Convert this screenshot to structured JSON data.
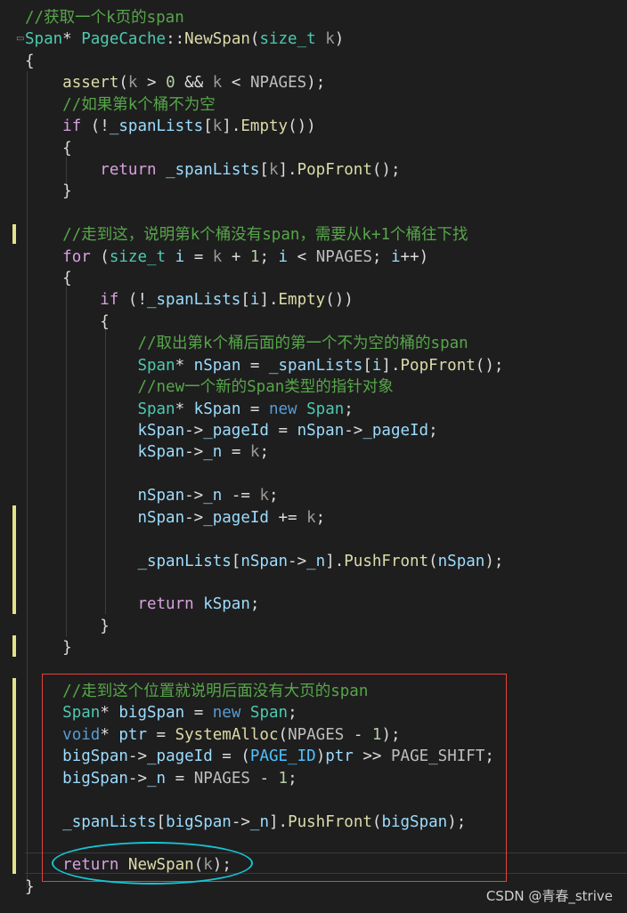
{
  "editor": {
    "lines": [
      [
        {
          "c": "comment",
          "t": "//获取一个k页的span"
        }
      ],
      [
        {
          "c": "type",
          "t": "Span"
        },
        {
          "c": "plain",
          "t": "* "
        },
        {
          "c": "type",
          "t": "PageCache"
        },
        {
          "c": "plain",
          "t": "::"
        },
        {
          "c": "func",
          "t": "NewSpan"
        },
        {
          "c": "plain",
          "t": "("
        },
        {
          "c": "type",
          "t": "size_t"
        },
        {
          "c": "plain",
          "t": " "
        },
        {
          "c": "param",
          "t": "k"
        },
        {
          "c": "plain",
          "t": ")"
        }
      ],
      [
        {
          "c": "plain",
          "t": "{"
        }
      ],
      [
        {
          "c": "plain",
          "t": "    "
        },
        {
          "c": "func",
          "t": "assert"
        },
        {
          "c": "plain",
          "t": "("
        },
        {
          "c": "param",
          "t": "k"
        },
        {
          "c": "plain",
          "t": " > "
        },
        {
          "c": "num",
          "t": "0"
        },
        {
          "c": "plain",
          "t": " && "
        },
        {
          "c": "param",
          "t": "k"
        },
        {
          "c": "plain",
          "t": " < "
        },
        {
          "c": "macro",
          "t": "NPAGES"
        },
        {
          "c": "plain",
          "t": ");"
        }
      ],
      [
        {
          "c": "plain",
          "t": "    "
        },
        {
          "c": "comment",
          "t": "//如果第k个桶不为空"
        }
      ],
      [
        {
          "c": "plain",
          "t": "    "
        },
        {
          "c": "ctrl",
          "t": "if"
        },
        {
          "c": "plain",
          "t": " (!"
        },
        {
          "c": "var",
          "t": "_spanLists"
        },
        {
          "c": "plain",
          "t": "["
        },
        {
          "c": "param",
          "t": "k"
        },
        {
          "c": "plain",
          "t": "]."
        },
        {
          "c": "func",
          "t": "Empty"
        },
        {
          "c": "plain",
          "t": "())"
        }
      ],
      [
        {
          "c": "plain",
          "t": "    {"
        }
      ],
      [
        {
          "c": "plain",
          "t": "        "
        },
        {
          "c": "ctrl",
          "t": "return"
        },
        {
          "c": "plain",
          "t": " "
        },
        {
          "c": "var",
          "t": "_spanLists"
        },
        {
          "c": "plain",
          "t": "["
        },
        {
          "c": "param",
          "t": "k"
        },
        {
          "c": "plain",
          "t": "]."
        },
        {
          "c": "func",
          "t": "PopFront"
        },
        {
          "c": "plain",
          "t": "();"
        }
      ],
      [
        {
          "c": "plain",
          "t": "    }"
        }
      ],
      [],
      [
        {
          "c": "plain",
          "t": "    "
        },
        {
          "c": "comment",
          "t": "//走到这，说明第k个桶没有span，需要从k+1个桶往下找"
        }
      ],
      [
        {
          "c": "plain",
          "t": "    "
        },
        {
          "c": "ctrl",
          "t": "for"
        },
        {
          "c": "plain",
          "t": " ("
        },
        {
          "c": "type",
          "t": "size_t"
        },
        {
          "c": "plain",
          "t": " "
        },
        {
          "c": "var",
          "t": "i"
        },
        {
          "c": "plain",
          "t": " = "
        },
        {
          "c": "param",
          "t": "k"
        },
        {
          "c": "plain",
          "t": " + "
        },
        {
          "c": "num",
          "t": "1"
        },
        {
          "c": "plain",
          "t": "; "
        },
        {
          "c": "var",
          "t": "i"
        },
        {
          "c": "plain",
          "t": " < "
        },
        {
          "c": "macro",
          "t": "NPAGES"
        },
        {
          "c": "plain",
          "t": "; "
        },
        {
          "c": "var",
          "t": "i"
        },
        {
          "c": "plain",
          "t": "++)"
        }
      ],
      [
        {
          "c": "plain",
          "t": "    {"
        }
      ],
      [
        {
          "c": "plain",
          "t": "        "
        },
        {
          "c": "ctrl",
          "t": "if"
        },
        {
          "c": "plain",
          "t": " (!"
        },
        {
          "c": "var",
          "t": "_spanLists"
        },
        {
          "c": "plain",
          "t": "["
        },
        {
          "c": "var",
          "t": "i"
        },
        {
          "c": "plain",
          "t": "]."
        },
        {
          "c": "func",
          "t": "Empty"
        },
        {
          "c": "plain",
          "t": "())"
        }
      ],
      [
        {
          "c": "plain",
          "t": "        {"
        }
      ],
      [
        {
          "c": "plain",
          "t": "            "
        },
        {
          "c": "comment",
          "t": "//取出第k个桶后面的第一个不为空的桶的span"
        }
      ],
      [
        {
          "c": "plain",
          "t": "            "
        },
        {
          "c": "type",
          "t": "Span"
        },
        {
          "c": "plain",
          "t": "* "
        },
        {
          "c": "var",
          "t": "nSpan"
        },
        {
          "c": "plain",
          "t": " = "
        },
        {
          "c": "var",
          "t": "_spanLists"
        },
        {
          "c": "plain",
          "t": "["
        },
        {
          "c": "var",
          "t": "i"
        },
        {
          "c": "plain",
          "t": "]."
        },
        {
          "c": "func",
          "t": "PopFront"
        },
        {
          "c": "plain",
          "t": "();"
        }
      ],
      [
        {
          "c": "plain",
          "t": "            "
        },
        {
          "c": "comment",
          "t": "//new一个新的Span类型的指针对象"
        }
      ],
      [
        {
          "c": "plain",
          "t": "            "
        },
        {
          "c": "type",
          "t": "Span"
        },
        {
          "c": "plain",
          "t": "* "
        },
        {
          "c": "var",
          "t": "kSpan"
        },
        {
          "c": "plain",
          "t": " = "
        },
        {
          "c": "kw",
          "t": "new"
        },
        {
          "c": "plain",
          "t": " "
        },
        {
          "c": "type",
          "t": "Span"
        },
        {
          "c": "plain",
          "t": ";"
        }
      ],
      [
        {
          "c": "plain",
          "t": "            "
        },
        {
          "c": "var",
          "t": "kSpan"
        },
        {
          "c": "plain",
          "t": "->"
        },
        {
          "c": "var",
          "t": "_pageId"
        },
        {
          "c": "plain",
          "t": " = "
        },
        {
          "c": "var",
          "t": "nSpan"
        },
        {
          "c": "plain",
          "t": "->"
        },
        {
          "c": "var",
          "t": "_pageId"
        },
        {
          "c": "plain",
          "t": ";"
        }
      ],
      [
        {
          "c": "plain",
          "t": "            "
        },
        {
          "c": "var",
          "t": "kSpan"
        },
        {
          "c": "plain",
          "t": "->"
        },
        {
          "c": "var",
          "t": "_n"
        },
        {
          "c": "plain",
          "t": " = "
        },
        {
          "c": "param",
          "t": "k"
        },
        {
          "c": "plain",
          "t": ";"
        }
      ],
      [],
      [
        {
          "c": "plain",
          "t": "            "
        },
        {
          "c": "var",
          "t": "nSpan"
        },
        {
          "c": "plain",
          "t": "->"
        },
        {
          "c": "var",
          "t": "_n"
        },
        {
          "c": "plain",
          "t": " -= "
        },
        {
          "c": "param",
          "t": "k"
        },
        {
          "c": "plain",
          "t": ";"
        }
      ],
      [
        {
          "c": "plain",
          "t": "            "
        },
        {
          "c": "var",
          "t": "nSpan"
        },
        {
          "c": "plain",
          "t": "->"
        },
        {
          "c": "var",
          "t": "_pageId"
        },
        {
          "c": "plain",
          "t": " += "
        },
        {
          "c": "param",
          "t": "k"
        },
        {
          "c": "plain",
          "t": ";"
        }
      ],
      [],
      [
        {
          "c": "plain",
          "t": "            "
        },
        {
          "c": "var",
          "t": "_spanLists"
        },
        {
          "c": "plain",
          "t": "["
        },
        {
          "c": "var",
          "t": "nSpan"
        },
        {
          "c": "plain",
          "t": "->"
        },
        {
          "c": "var",
          "t": "_n"
        },
        {
          "c": "plain",
          "t": "]."
        },
        {
          "c": "func",
          "t": "PushFront"
        },
        {
          "c": "plain",
          "t": "("
        },
        {
          "c": "var",
          "t": "nSpan"
        },
        {
          "c": "plain",
          "t": ");"
        }
      ],
      [],
      [
        {
          "c": "plain",
          "t": "            "
        },
        {
          "c": "ctrl",
          "t": "return"
        },
        {
          "c": "plain",
          "t": " "
        },
        {
          "c": "var",
          "t": "kSpan"
        },
        {
          "c": "plain",
          "t": ";"
        }
      ],
      [
        {
          "c": "plain",
          "t": "        }"
        }
      ],
      [
        {
          "c": "plain",
          "t": "    }"
        }
      ],
      [],
      [
        {
          "c": "plain",
          "t": "    "
        },
        {
          "c": "comment",
          "t": "//走到这个位置就说明后面没有大页的span"
        }
      ],
      [
        {
          "c": "plain",
          "t": "    "
        },
        {
          "c": "type",
          "t": "Span"
        },
        {
          "c": "plain",
          "t": "* "
        },
        {
          "c": "var",
          "t": "bigSpan"
        },
        {
          "c": "plain",
          "t": " = "
        },
        {
          "c": "kw",
          "t": "new"
        },
        {
          "c": "plain",
          "t": " "
        },
        {
          "c": "type",
          "t": "Span"
        },
        {
          "c": "plain",
          "t": ";"
        }
      ],
      [
        {
          "c": "plain",
          "t": "    "
        },
        {
          "c": "kw",
          "t": "void"
        },
        {
          "c": "plain",
          "t": "* "
        },
        {
          "c": "var",
          "t": "ptr"
        },
        {
          "c": "plain",
          "t": " = "
        },
        {
          "c": "func",
          "t": "SystemAlloc"
        },
        {
          "c": "plain",
          "t": "("
        },
        {
          "c": "macro",
          "t": "NPAGES"
        },
        {
          "c": "plain",
          "t": " - "
        },
        {
          "c": "num",
          "t": "1"
        },
        {
          "c": "plain",
          "t": ");"
        }
      ],
      [
        {
          "c": "plain",
          "t": "    "
        },
        {
          "c": "var",
          "t": "bigSpan"
        },
        {
          "c": "plain",
          "t": "->"
        },
        {
          "c": "var",
          "t": "_pageId"
        },
        {
          "c": "plain",
          "t": " = ("
        },
        {
          "c": "enum",
          "t": "PAGE_ID"
        },
        {
          "c": "plain",
          "t": ")"
        },
        {
          "c": "var",
          "t": "ptr"
        },
        {
          "c": "plain",
          "t": " >> "
        },
        {
          "c": "macro",
          "t": "PAGE_SHIFT"
        },
        {
          "c": "plain",
          "t": ";"
        }
      ],
      [
        {
          "c": "plain",
          "t": "    "
        },
        {
          "c": "var",
          "t": "bigSpan"
        },
        {
          "c": "plain",
          "t": "->"
        },
        {
          "c": "var",
          "t": "_n"
        },
        {
          "c": "plain",
          "t": " = "
        },
        {
          "c": "macro",
          "t": "NPAGES"
        },
        {
          "c": "plain",
          "t": " - "
        },
        {
          "c": "num",
          "t": "1"
        },
        {
          "c": "plain",
          "t": ";"
        }
      ],
      [],
      [
        {
          "c": "plain",
          "t": "    "
        },
        {
          "c": "var",
          "t": "_spanLists"
        },
        {
          "c": "plain",
          "t": "["
        },
        {
          "c": "var",
          "t": "bigSpan"
        },
        {
          "c": "plain",
          "t": "->"
        },
        {
          "c": "var",
          "t": "_n"
        },
        {
          "c": "plain",
          "t": "]."
        },
        {
          "c": "func",
          "t": "PushFront"
        },
        {
          "c": "plain",
          "t": "("
        },
        {
          "c": "var",
          "t": "bigSpan"
        },
        {
          "c": "plain",
          "t": ");"
        }
      ],
      [],
      [
        {
          "c": "plain",
          "t": "    "
        },
        {
          "c": "ctrl",
          "t": "return"
        },
        {
          "c": "plain",
          "t": " "
        },
        {
          "c": "func",
          "t": "NewSpan"
        },
        {
          "c": "plain",
          "t": "("
        },
        {
          "c": "param",
          "t": "k"
        },
        {
          "c": "plain",
          "t": ");"
        }
      ],
      [
        {
          "c": "plain",
          "t": "}"
        }
      ]
    ]
  },
  "watermark": "CSDN @青春_strive",
  "colors": {
    "background": "#1e1e1e",
    "annotation_box": "#e2433d",
    "annotation_ellipse": "#16c3d3",
    "change_marker": "#e2e28b"
  }
}
